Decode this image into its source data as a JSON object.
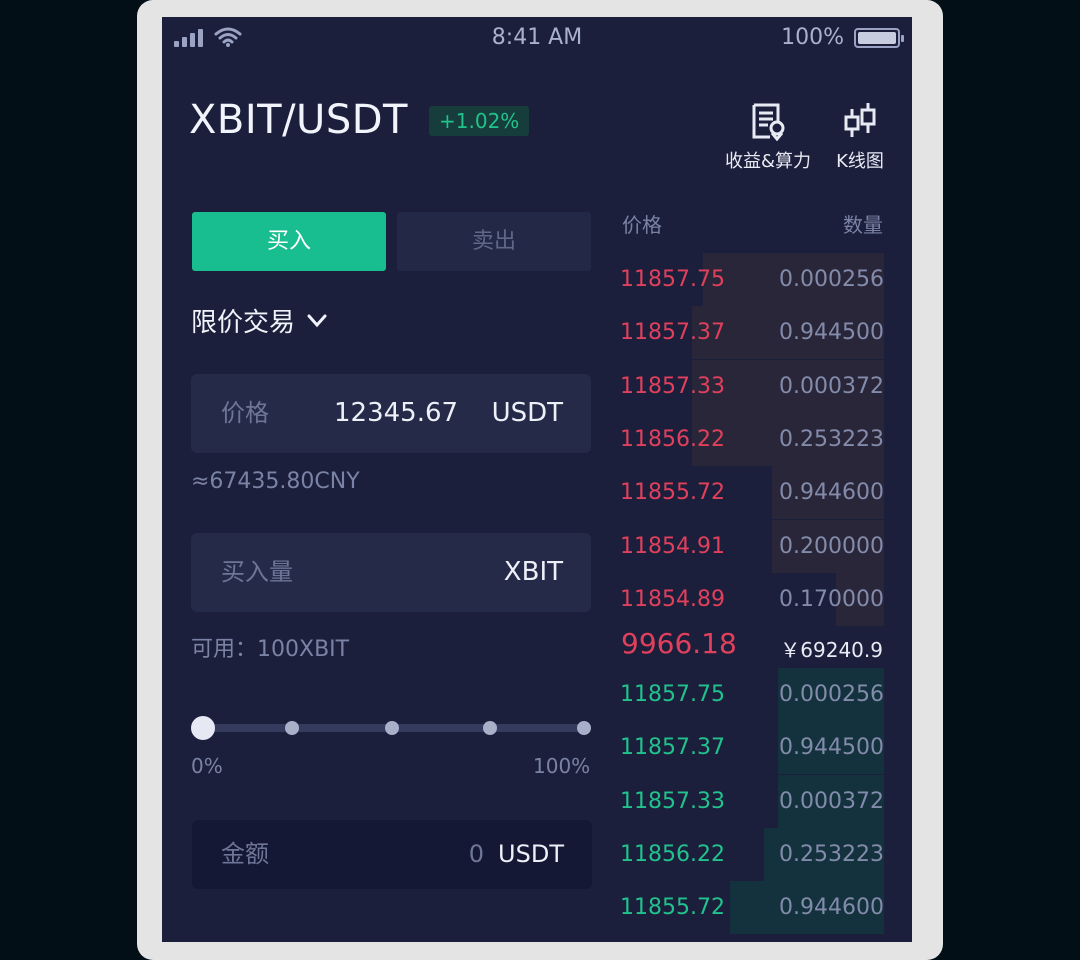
{
  "status_bar": {
    "time": "8:41 AM",
    "battery": "100%",
    "icons": [
      "signal-icon",
      "wifi-icon",
      "battery-icon"
    ]
  },
  "header": {
    "pair": "XBIT/USDT",
    "change": "+1.02%",
    "actions": [
      {
        "label": "收益&算力",
        "icon": "report-icon"
      },
      {
        "label": "K线图",
        "icon": "candlestick-icon"
      }
    ]
  },
  "trade": {
    "tabs": {
      "buy": "买入",
      "sell": "卖出"
    },
    "order_type": "限价交易",
    "price_field": {
      "label": "价格",
      "value": "12345.67",
      "unit": "USDT"
    },
    "cny_hint": "≈67435.80CNY",
    "amount_field": {
      "label": "买入量",
      "unit": "XBIT"
    },
    "available": "可用：100XBIT",
    "slider": {
      "min_label": "0%",
      "max_label": "100%",
      "value": 0
    },
    "total_field": {
      "label": "金额",
      "value": "0",
      "unit": "USDT"
    }
  },
  "order_book": {
    "headers": {
      "price": "价格",
      "quantity": "数量"
    },
    "asks": [
      {
        "price": "11857.75",
        "qty": "0.000256",
        "depth": 0.68
      },
      {
        "price": "11857.37",
        "qty": "0.944500",
        "depth": 0.72
      },
      {
        "price": "11857.33",
        "qty": "0.000372",
        "depth": 0.72
      },
      {
        "price": "11856.22",
        "qty": "0.253223",
        "depth": 0.72
      },
      {
        "price": "11855.72",
        "qty": "0.944600",
        "depth": 0.42
      },
      {
        "price": "11854.91",
        "qty": "0.200000",
        "depth": 0.42
      },
      {
        "price": "11854.89",
        "qty": "0.170000",
        "depth": 0.18
      }
    ],
    "last_price": "9966.18",
    "last_price_cny": "￥69240.9",
    "bids": [
      {
        "price": "11857.75",
        "qty": "0.000256",
        "depth": 0.4
      },
      {
        "price": "11857.37",
        "qty": "0.944500",
        "depth": 0.4
      },
      {
        "price": "11857.33",
        "qty": "0.000372",
        "depth": 0.4
      },
      {
        "price": "11856.22",
        "qty": "0.253223",
        "depth": 0.45
      },
      {
        "price": "11855.72",
        "qty": "0.944600",
        "depth": 0.58
      }
    ]
  },
  "colors": {
    "background": "#1b1f3b",
    "buy_green": "#18be8f",
    "ask_red": "#e0405c",
    "bid_green": "#21c28c"
  }
}
